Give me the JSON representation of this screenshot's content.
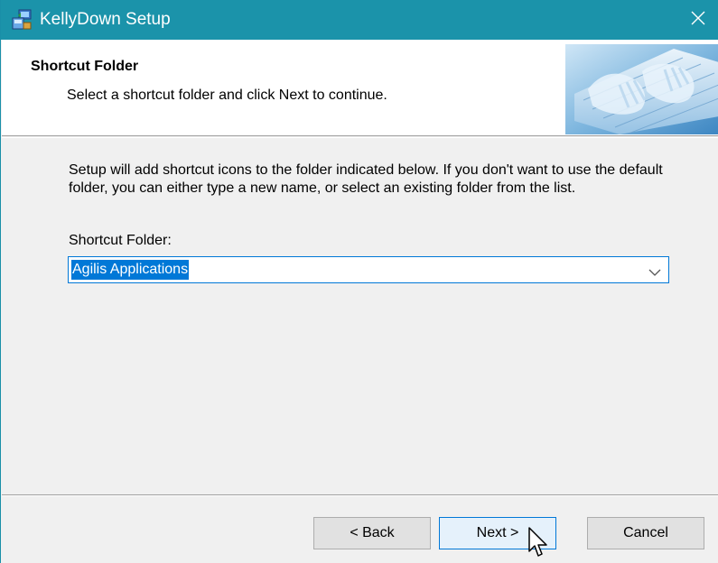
{
  "window": {
    "title": "KellyDown Setup",
    "title_icon": "setup-icon",
    "close_glyph": "✕"
  },
  "header": {
    "title": "Shortcut Folder",
    "description": "Select a shortcut folder and click Next to continue.",
    "image": "keyboard-hands-image"
  },
  "body": {
    "instructions": "Setup will add shortcut icons to the folder indicated below. If you don't want to use the default folder, you can either type a new name, or select an existing folder from the list.",
    "field_label": "Shortcut Folder:",
    "folder_value": "Agilis Applications"
  },
  "buttons": {
    "back": "< Back",
    "next": "Next >",
    "cancel": "Cancel"
  },
  "colors": {
    "titlebar": "#1b93aa",
    "selection": "#0078d7",
    "window_bg": "#f0f0f0"
  }
}
